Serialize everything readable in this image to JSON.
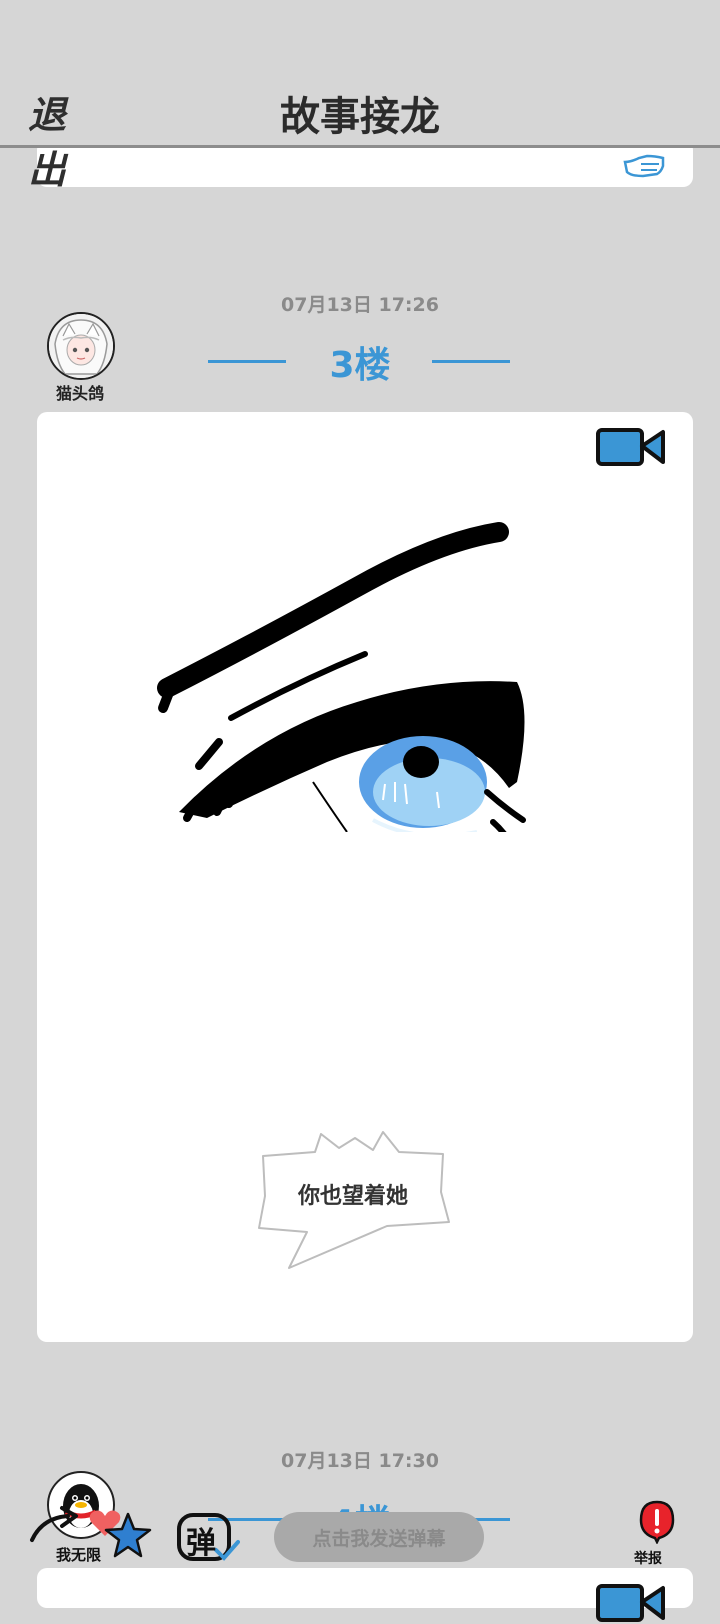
{
  "header": {
    "exit_label": "退 出",
    "title": "故事接龙"
  },
  "post3": {
    "timestamp": "07月13日  17:26",
    "floor_label": "3楼",
    "username": "猫头鸽",
    "bubble_text": "你也望着她"
  },
  "post4": {
    "timestamp": "07月13日  17:30",
    "floor_label": "4楼"
  },
  "bottom": {
    "username": "我无限",
    "danmaku_placeholder": "点击我发送弹幕",
    "danmaku_toggle_label": "弹",
    "report_label": "举报"
  },
  "colors": {
    "accent": "#3b96d5",
    "background": "#d6d6d6",
    "report_red": "#e8232b"
  }
}
